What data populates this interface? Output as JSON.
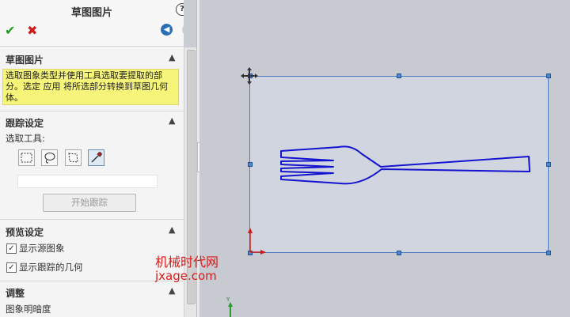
{
  "header": {
    "title": "草图图片",
    "help_label": "?",
    "ok_label": "✔",
    "cancel_label": "✖"
  },
  "sections": {
    "sketch_picture": {
      "title": "草图图片",
      "message": "选取图象类型并使用工具选取要提取的部分。选定 应用 将所选部分转换到草图几何体。"
    },
    "trace_settings": {
      "title": "跟踪设定",
      "select_tool_label": "选取工具:",
      "begin_trace_button": "开始跟踪"
    },
    "preview_settings": {
      "title": "预览设定",
      "show_source_image": {
        "label": "显示源图象",
        "checked": true
      },
      "show_traced_geometry": {
        "label": "显示跟踪的几何",
        "checked": true
      }
    },
    "adjust": {
      "title": "调整",
      "image_brightness_label": "图象明暗度"
    }
  },
  "canvas": {
    "axis_label_y": "Y",
    "fork_color": "#1414d0",
    "frame_color": "#4a7cc6"
  },
  "watermark": {
    "cn": "机械时代网",
    "en": "jxage.com",
    "color": "#e01818"
  }
}
